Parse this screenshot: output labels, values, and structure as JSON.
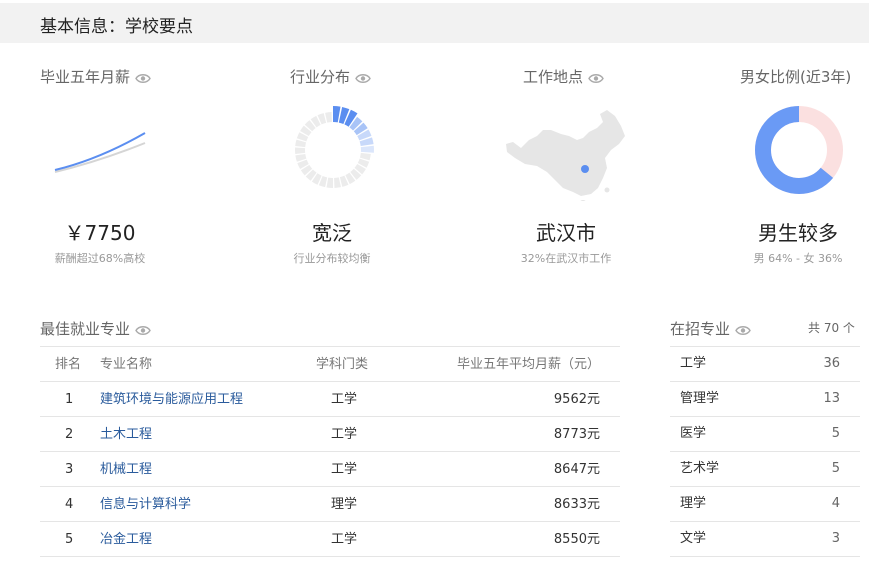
{
  "header": {
    "title": "基本信息：学校要点"
  },
  "stats": {
    "salary": {
      "title": "毕业五年月薪",
      "value": "￥7750",
      "sub": "薪酬超过68%高校"
    },
    "industry": {
      "title": "行业分布",
      "value": "宽泛",
      "sub": "行业分布较均衡"
    },
    "location": {
      "title": "工作地点",
      "value": "武汉市",
      "sub": "32%在武汉市工作"
    },
    "gender": {
      "title": "男女比例(近3年)",
      "value": "男生较多",
      "sub": "男 64% - 女 36%",
      "male_fraction": 0.64
    }
  },
  "majors_best": {
    "title": "最佳就业专业",
    "headers": {
      "rank": "排名",
      "name": "专业名称",
      "category": "学科门类",
      "salary": "毕业五年平均月薪（元）"
    },
    "rows": [
      {
        "rank": "1",
        "name": "建筑环境与能源应用工程",
        "category": "工学",
        "salary": "9562元"
      },
      {
        "rank": "2",
        "name": "土木工程",
        "category": "工学",
        "salary": "8773元"
      },
      {
        "rank": "3",
        "name": "机械工程",
        "category": "工学",
        "salary": "8647元"
      },
      {
        "rank": "4",
        "name": "信息与计算科学",
        "category": "理学",
        "salary": "8633元"
      },
      {
        "rank": "5",
        "name": "冶金工程",
        "category": "工学",
        "salary": "8550元"
      }
    ]
  },
  "majors_enrolling": {
    "title": "在招专业",
    "total": "共 70 个",
    "items": [
      {
        "name": "工学",
        "count": "36"
      },
      {
        "name": "管理学",
        "count": "13"
      },
      {
        "name": "医学",
        "count": "5"
      },
      {
        "name": "艺术学",
        "count": "5"
      },
      {
        "name": "理学",
        "count": "4"
      },
      {
        "name": "文学",
        "count": "3"
      }
    ]
  },
  "colors": {
    "accent": "#6a9af5",
    "female": "#fbe0e0",
    "map": "#e8e8e8",
    "link": "#2a5b9c"
  }
}
